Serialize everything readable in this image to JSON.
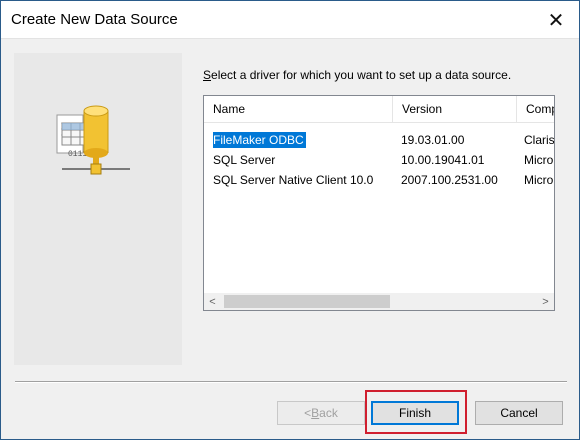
{
  "window": {
    "title": "Create New Data Source",
    "close_glyph": "✕"
  },
  "prompt": {
    "accelerator": "S",
    "text_rest": "elect a driver for which you want to set up a data source."
  },
  "listview": {
    "columns": [
      "Name",
      "Version",
      "Comp"
    ],
    "rows": [
      {
        "name": "FileMaker ODBC",
        "version": "19.03.01.00",
        "company": "Claris",
        "selected": true
      },
      {
        "name": "SQL Server",
        "version": "10.00.19041.01",
        "company": "Micro",
        "selected": false
      },
      {
        "name": "SQL Server Native Client 10.0",
        "version": "2007.100.2531.00",
        "company": "Micro",
        "selected": false
      }
    ],
    "scroll_left_glyph": "<",
    "scroll_right_glyph": ">"
  },
  "buttons": {
    "back_prefix": "< ",
    "back_accel": "B",
    "back_rest": "ack",
    "finish": "Finish",
    "cancel": "Cancel"
  },
  "icons": {
    "illustration": "database-driver-icon"
  },
  "colors": {
    "selection": "#0078d7",
    "highlight_box": "#d01f2f",
    "default_button_border": "#0078d7"
  }
}
